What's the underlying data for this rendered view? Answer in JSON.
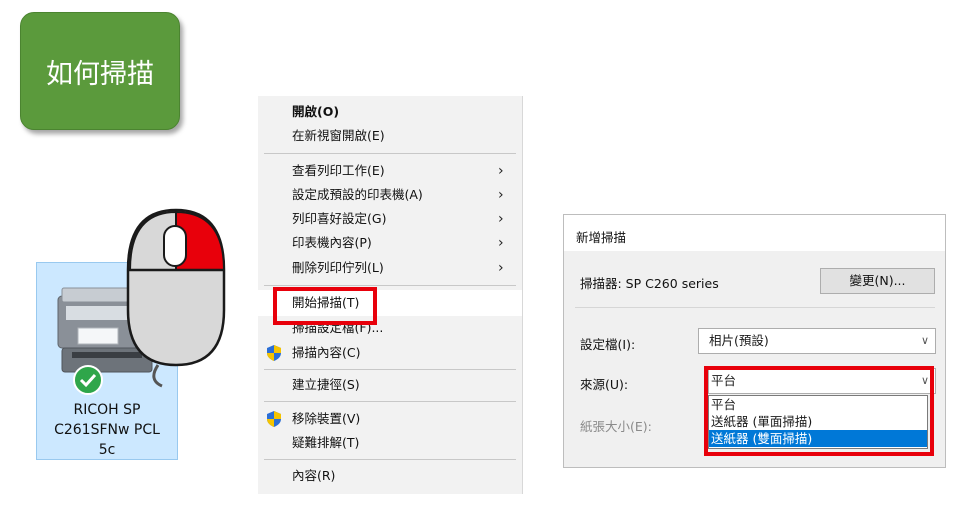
{
  "badge": {
    "title": "如何掃描"
  },
  "printer": {
    "label_line1": "RICOH SP",
    "label_line2": "C261SFNw PCL",
    "label_line3": "5c",
    "icon": "printer-icon",
    "status_icon": "checkmark-icon"
  },
  "mouse": {
    "icon": "mouse-right-click-icon",
    "highlight_color": "#e8000b"
  },
  "menu": {
    "items": [
      {
        "label": "開啟(O)",
        "bold": true
      },
      {
        "label": "在新視窗開啟(E)"
      },
      {
        "label": "查看列印工作(E)",
        "submenu": true
      },
      {
        "label": "設定成預設的印表機(A)",
        "submenu": true
      },
      {
        "label": "列印喜好設定(G)",
        "submenu": true
      },
      {
        "label": "印表機內容(P)",
        "submenu": true
      },
      {
        "label": "刪除列印佇列(L)",
        "submenu": true
      },
      {
        "label": "開始掃描(T)",
        "highlighted": true
      },
      {
        "label": "掃描設定檔(F)..."
      },
      {
        "label": "掃描內容(C)",
        "icon": "shield-icon"
      },
      {
        "label": "建立捷徑(S)"
      },
      {
        "label": "移除裝置(V)",
        "icon": "shield-icon"
      },
      {
        "label": "疑難排解(T)"
      },
      {
        "label": "內容(R)"
      }
    ]
  },
  "dialog": {
    "title": "新增掃描",
    "scanner_label": "掃描器: SP C260 series",
    "change_button": "變更(N)...",
    "profile_label": "設定檔(I):",
    "profile_value": "相片(預設)",
    "source_label": "來源(U):",
    "source_value": "平台",
    "paper_label": "紙張大小(E):",
    "source_options": [
      "平台",
      "送紙器 (單面掃描)",
      "送紙器 (雙面掃描)"
    ],
    "selected_option_index": 2
  },
  "colors": {
    "badge_green": "#5b9a3c",
    "callout_red": "#e8000b",
    "selection_blue": "#0078d7"
  }
}
